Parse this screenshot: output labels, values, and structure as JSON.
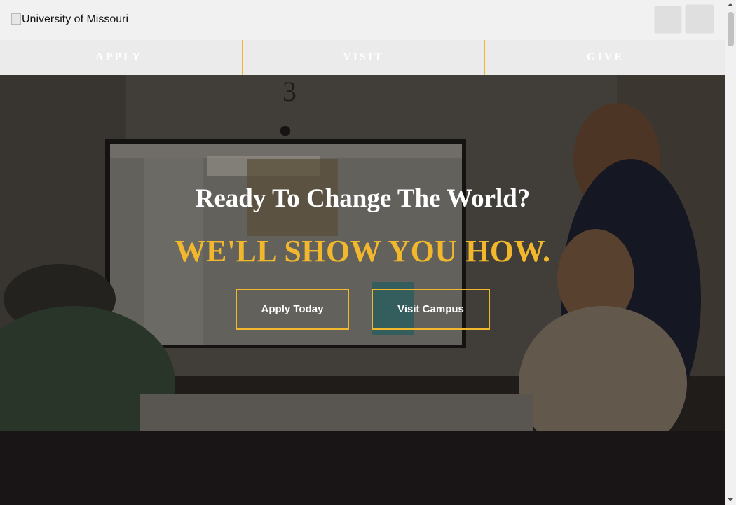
{
  "header": {
    "logo_alt": "University of Missouri",
    "search_icon": "search-icon",
    "menu_icon": "menu-icon"
  },
  "nav": {
    "items": [
      {
        "label": "APPLY"
      },
      {
        "label": "VISIT"
      },
      {
        "label": "GIVE"
      }
    ]
  },
  "hero": {
    "title": "Ready To Change The World?",
    "subtitle": "WE'LL SHOW YOU HOW.",
    "buttons": {
      "apply": "Apply Today",
      "visit": "Visit Campus"
    }
  },
  "colors": {
    "gold": "#f1b82d",
    "black": "#191516"
  }
}
